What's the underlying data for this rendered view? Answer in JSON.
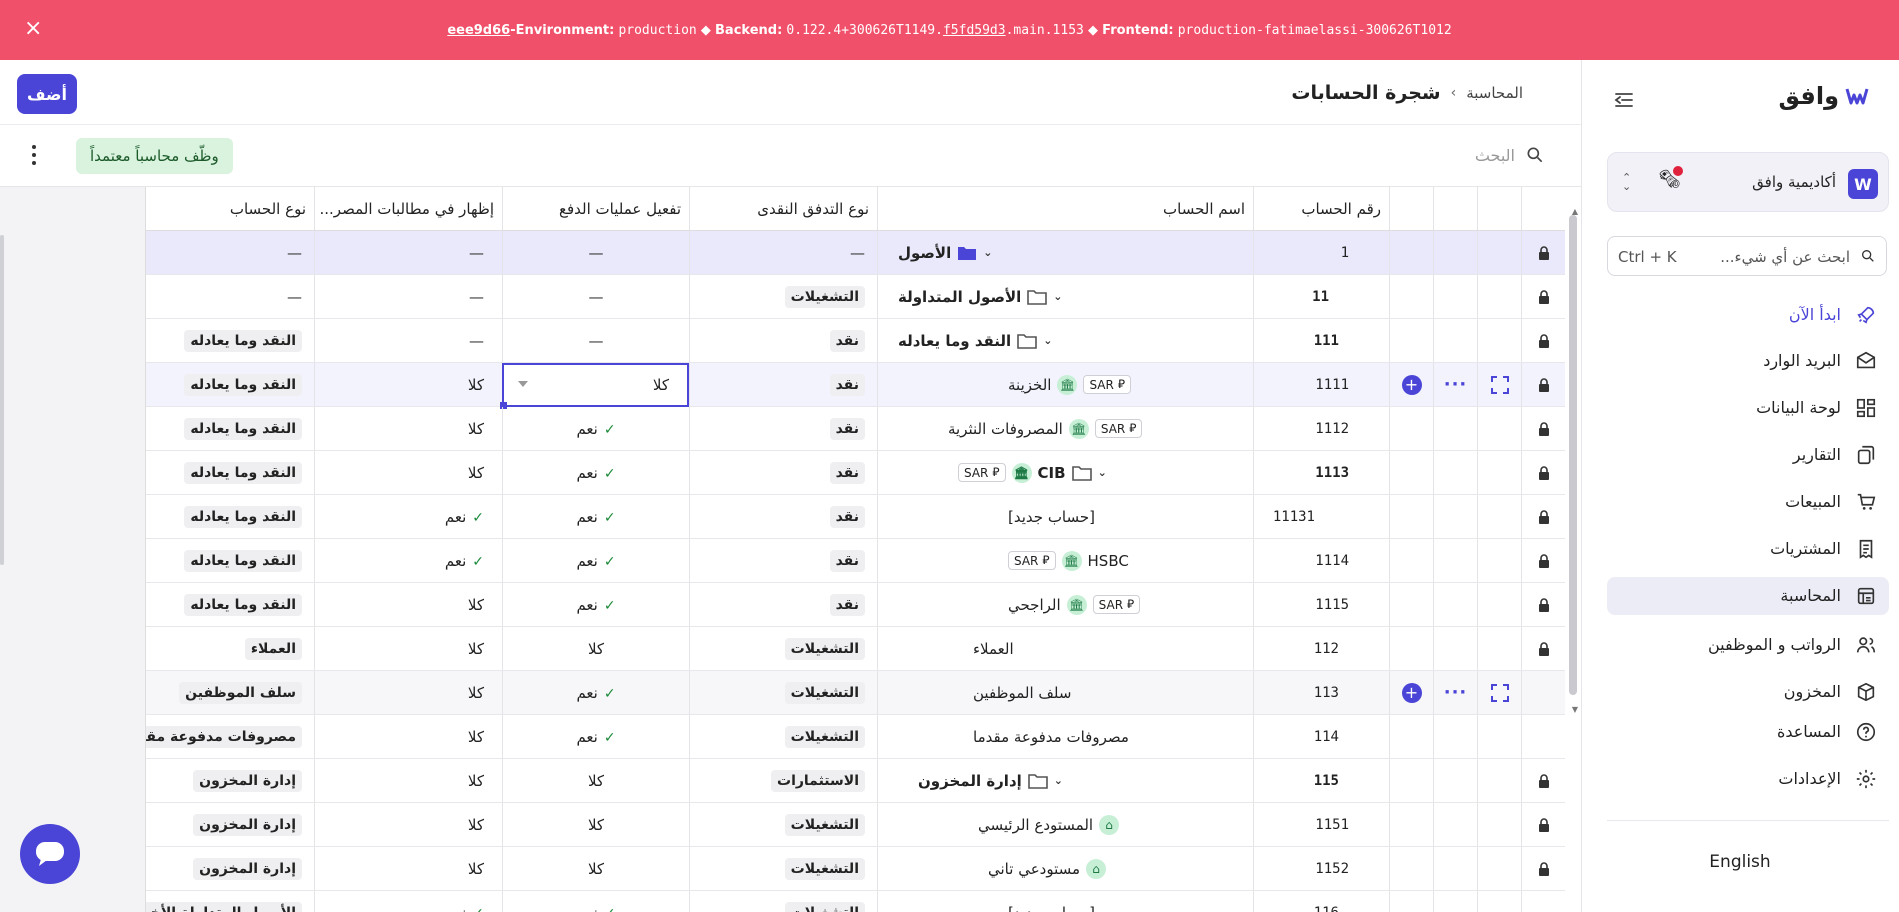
{
  "banner": {
    "hash": "eee9d66",
    "env_label": "-Environment:",
    "env_value": "production",
    "sep": "◆",
    "backend_label": "Backend:",
    "backend_pre": "0.122.4+300626T1149.",
    "backend_link": "f5fd59d3",
    "backend_post": ".main.1153",
    "frontend_label": "Frontend:",
    "frontend_value": "production-fatimaelassi-300626T1012",
    "close": "×"
  },
  "sidebar": {
    "logo": "وافق",
    "org": {
      "name": "أكاديمية وافق",
      "icon_letter": "W"
    },
    "search": {
      "placeholder": "ابحث عن أي شيء...",
      "shortcut": "Ctrl + K"
    },
    "items": [
      {
        "label": "ابدأ الآن",
        "icon": "rocket-icon"
      },
      {
        "label": "البريد الوارد",
        "icon": "inbox-icon"
      },
      {
        "label": "لوحة البيانات",
        "icon": "dashboard-icon"
      },
      {
        "label": "التقارير",
        "icon": "reports-icon"
      },
      {
        "label": "المبيعات",
        "icon": "cart-icon"
      },
      {
        "label": "المشتريات",
        "icon": "receipt-icon"
      },
      {
        "label": "المحاسبة",
        "icon": "ledger-icon"
      },
      {
        "label": "الرواتب و الموظفين",
        "icon": "users-icon"
      },
      {
        "label": "المخزون",
        "icon": "box-icon"
      },
      {
        "label": "المساعدة",
        "icon": "help-icon"
      },
      {
        "label": "الإعدادات",
        "icon": "gear-icon"
      }
    ],
    "language": "English"
  },
  "header": {
    "breadcrumb_parent": "المحاسبة",
    "breadcrumb_sep": "›",
    "title": "شجرة الحسابات",
    "add_label": "أضف"
  },
  "toolbar": {
    "search_placeholder": "البحث",
    "hire_label": "وظّف محاسباً معتمداً"
  },
  "table": {
    "columns": {
      "num": "رقم الحساب",
      "name": "اسم الحساب",
      "cash": "نوع التدفق النقدى",
      "pay": "تفعيل عمليات الدفع",
      "show": "إظهار في مطالبات المصر...",
      "type": "نوع الحساب"
    },
    "rows": [
      {
        "num": "1",
        "name": "الأصول",
        "cash": "—",
        "pay": "—",
        "show": "—",
        "type": "—"
      },
      {
        "num": "11",
        "name": "الأصول المتداولة",
        "cash": "التشغيلات",
        "pay": "—",
        "show": "—",
        "type": "—"
      },
      {
        "num": "111",
        "name": "النقد وما يعادله",
        "cash": "نقد",
        "pay": "—",
        "show": "—",
        "type": "النقد وما يعادله"
      },
      {
        "num": "1111",
        "name": "الخزينة",
        "currency": "SAR",
        "cash": "نقد",
        "pay": "كلا",
        "show": "كلا",
        "type": "النقد وما يعادله"
      },
      {
        "num": "1112",
        "name": "المصروفات النثرية",
        "currency": "SAR",
        "cash": "نقد",
        "pay": "نعم",
        "show": "كلا",
        "type": "النقد وما يعادله"
      },
      {
        "num": "1113",
        "name": "CIB",
        "currency": "SAR",
        "cash": "نقد",
        "pay": "نعم",
        "show": "كلا",
        "type": "النقد وما يعادله"
      },
      {
        "num": "11131",
        "name": "[حساب جديد]",
        "cash": "نقد",
        "pay": "نعم",
        "show": "نعم",
        "type": "النقد وما يعادله"
      },
      {
        "num": "1114",
        "name": "HSBC",
        "currency": "SAR",
        "cash": "نقد",
        "pay": "نعم",
        "show": "نعم",
        "type": "النقد وما يعادله"
      },
      {
        "num": "1115",
        "name": "الراجحي",
        "currency": "SAR",
        "cash": "نقد",
        "pay": "نعم",
        "show": "كلا",
        "type": "النقد وما يعادله"
      },
      {
        "num": "112",
        "name": "العملاء",
        "cash": "التشغيلات",
        "pay": "كلا",
        "show": "كلا",
        "type": "العملاء"
      },
      {
        "num": "113",
        "name": "سلف الموظفين",
        "cash": "التشغيلات",
        "pay": "نعم",
        "show": "كلا",
        "type": "سلف الموظفين"
      },
      {
        "num": "114",
        "name": "مصروفات مدفوعة مقدما",
        "cash": "التشغيلات",
        "pay": "نعم",
        "show": "كلا",
        "type": "مصروفات مدفوعة مقدما"
      },
      {
        "num": "115",
        "name": "إدارة المخزون",
        "cash": "الاستثمارات",
        "pay": "كلا",
        "show": "كلا",
        "type": "إدارة المخزون"
      },
      {
        "num": "1151",
        "name": "المستودع الرئيسي",
        "cash": "التشغيلات",
        "pay": "كلا",
        "show": "كلا",
        "type": "إدارة المخزون"
      },
      {
        "num": "1152",
        "name": "مستودعي تاني",
        "cash": "التشغيلات",
        "pay": "كلا",
        "show": "كلا",
        "type": "إدارة المخزون"
      },
      {
        "num": "116",
        "name": "[حساب جديد]",
        "cash": "التشغيلات",
        "pay": "نعم",
        "show": "نعم",
        "type": "الأصول المتداولة الأخرى"
      }
    ]
  },
  "colors": {
    "accent": "#4a45d6",
    "banner": "#f0506a",
    "success": "#d9f3de"
  }
}
